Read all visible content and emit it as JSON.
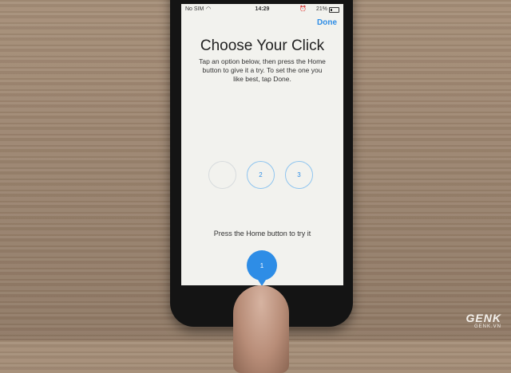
{
  "status_bar": {
    "carrier": "No SIM",
    "time": "14:29",
    "battery": "21%"
  },
  "nav": {
    "done_label": "Done"
  },
  "page": {
    "title": "Choose Your Click",
    "instructions": "Tap an option below, then press the Home button to give it a try. To set the one you like best, tap Done.",
    "hint": "Press the Home button to try it"
  },
  "options": [
    {
      "label": "",
      "selected": true
    },
    {
      "label": "2",
      "selected": false
    },
    {
      "label": "3",
      "selected": false
    }
  ],
  "home_indicator": {
    "label": "1"
  },
  "watermark": {
    "brand": "GENK",
    "site": "GENK.VN"
  },
  "colors": {
    "accent": "#2e8de6",
    "screen_bg": "#f2f2ee"
  },
  "icons": [
    "wifi-icon",
    "alarm-icon",
    "battery-icon"
  ]
}
